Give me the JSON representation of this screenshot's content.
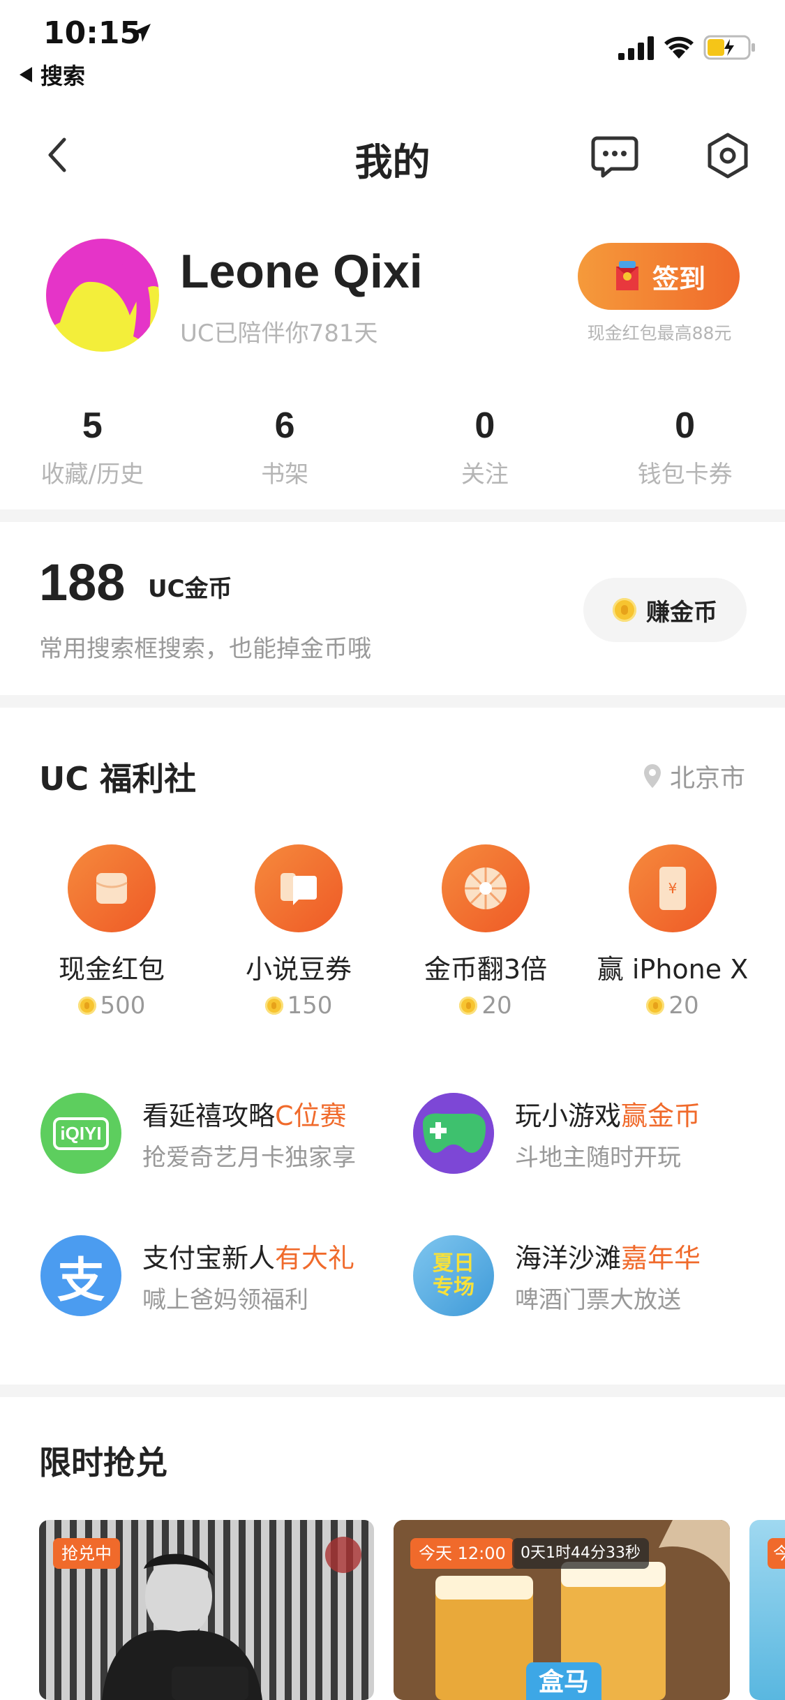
{
  "status_bar": {
    "time": "10:15",
    "back_app": "搜索"
  },
  "nav": {
    "title": "我的",
    "icons": [
      "back-icon",
      "message-icon",
      "gear-icon"
    ]
  },
  "profile": {
    "name": "Leone Qixi",
    "days": "UC已陪伴你781天",
    "checkin_label": "签到",
    "checkin_note": "现金红包最高88元"
  },
  "stats": [
    {
      "num": "5",
      "label": "收藏/历史"
    },
    {
      "num": "6",
      "label": "书架"
    },
    {
      "num": "0",
      "label": "关注"
    },
    {
      "num": "0",
      "label": "钱包卡券"
    }
  ],
  "coins": {
    "amount": "188",
    "unit": "UC金币",
    "tip": "常用搜索框搜索，也能掉金币哦",
    "earn_label": "赚金币"
  },
  "welfare": {
    "title": "UC 福利社",
    "location": "北京市",
    "items": [
      {
        "label": "现金红包",
        "points": "500",
        "icon": "envelope-icon"
      },
      {
        "label": "小说豆券",
        "points": "150",
        "icon": "ticket-icon"
      },
      {
        "label": "金币翻3倍",
        "points": "20",
        "icon": "wheel-icon"
      },
      {
        "label": "赢 iPhone X",
        "points": "20",
        "icon": "phone-icon"
      }
    ],
    "promos": [
      {
        "title_a": "看延禧攻略",
        "title_b": "C位赛",
        "sub": "抢爱奇艺月卡独家享",
        "icon_text": "iQIYI"
      },
      {
        "title_a": "玩小游戏",
        "title_b": "赢金币",
        "sub": "斗地主随时开玩"
      },
      {
        "title_a": "支付宝新人",
        "title_b": "有大礼",
        "sub": "喊上爸妈领福利",
        "icon_text": "支"
      },
      {
        "title_a": "海洋沙滩",
        "title_b": "嘉年华",
        "sub": "啤酒门票大放送",
        "icon_text_1": "夏日",
        "icon_text_2": "专场"
      }
    ]
  },
  "flash": {
    "title": "限时抢兑",
    "cards": [
      {
        "tag": "抢兑中"
      },
      {
        "tag": "今天 12:00",
        "timer": "0天1时44分33秒",
        "badge": "盒马"
      },
      {
        "tag": "今"
      }
    ]
  },
  "colors": {
    "accent": "#f06a2b",
    "accent_light": "#f59a3b",
    "divider": "#f4f4f4",
    "muted": "#b5b5b5"
  }
}
